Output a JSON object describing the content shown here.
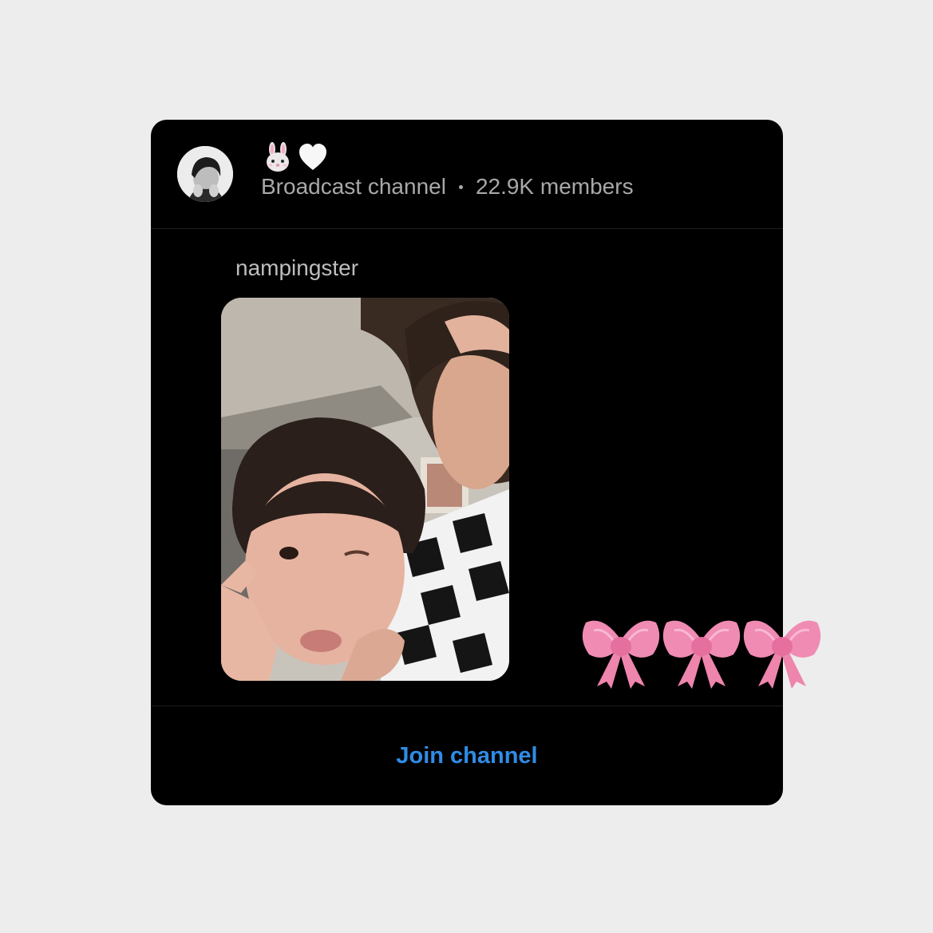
{
  "channel": {
    "name_icons": [
      "rabbit-face-icon",
      "white-heart-icon"
    ],
    "type_label": "Broadcast channel",
    "members_label": "22.9K members"
  },
  "message": {
    "sender": "nampingster",
    "attachment": "photo"
  },
  "actions": {
    "join_label": "Join channel"
  },
  "decoration": {
    "icons": [
      "pink-bow-icon",
      "pink-bow-icon",
      "pink-bow-icon"
    ],
    "bow_color": "#f08bb4"
  },
  "colors": {
    "page_background": "#ededed",
    "card_background": "#000000",
    "secondary_text": "#a8a8a8",
    "accent": "#2f8ce6"
  }
}
